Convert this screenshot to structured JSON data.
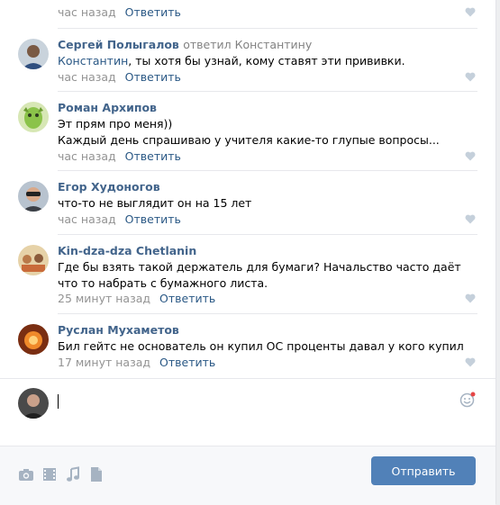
{
  "comments": [
    {
      "author": "",
      "text": "",
      "time": "час назад",
      "reply_label": "Ответить"
    },
    {
      "author": "Сергей Полыгалов",
      "reply_to": "ответил Константину",
      "mention": "Константин",
      "text": ", ты хотя бы узнай, кому ставят эти прививки.",
      "time": "час назад",
      "reply_label": "Ответить"
    },
    {
      "author": "Роман Архипов",
      "text": "Эт прям про меня))\nКаждый день спрашиваю у учителя какие-то глупые вопросы...",
      "time": "час назад",
      "reply_label": "Ответить"
    },
    {
      "author": "Егор Худоногов",
      "text": "что-то не выглядит он на 15 лет",
      "time": "час назад",
      "reply_label": "Ответить"
    },
    {
      "author": "Kin-dza-dza Chetlanin",
      "text": "Где бы взять такой держатель для бумаги? Начальство часто даёт что то набрать с бумажного листа.",
      "time": "25 минут назад",
      "reply_label": "Ответить"
    },
    {
      "author": "Руслан Мухаметов",
      "text": "Бил гейтс не основатель он купил ОС проценты давал у кого купил",
      "time": "17 минут назад",
      "reply_label": "Ответить"
    }
  ],
  "composer": {
    "input_value": "",
    "send_label": "Отправить"
  },
  "colors": {
    "link": "#2a5885",
    "author": "#42648b",
    "meta": "#939393",
    "button": "#5181b8"
  },
  "icons": [
    "heart-icon",
    "emoji-icon",
    "camera-icon",
    "video-icon",
    "music-icon",
    "document-icon"
  ]
}
